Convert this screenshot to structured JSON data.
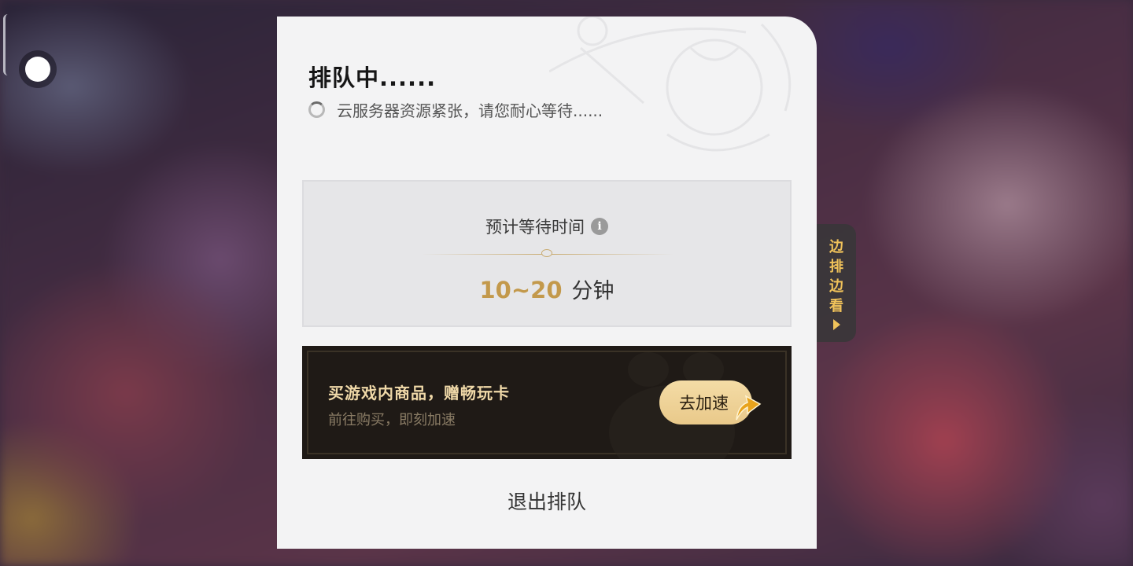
{
  "queue": {
    "title": "排队中......",
    "status_text": "云服务器资源紧张，请您耐心等待......"
  },
  "wait": {
    "label": "预计等待时间",
    "info_icon": "info-icon",
    "time_value": "10~20",
    "time_unit": "分钟"
  },
  "promo": {
    "title": "买游戏内商品，赠畅玩卡",
    "subtitle": "前往购买，即刻加速",
    "button_label": "去加速"
  },
  "exit": {
    "label": "退出排队"
  },
  "side_tab": {
    "label": "边排边看"
  },
  "colors": {
    "accent_gold": "#c3994b",
    "promo_button": "#f4dca6",
    "side_tab_text": "#f0c25a",
    "panel_bg": "#f3f3f4"
  }
}
